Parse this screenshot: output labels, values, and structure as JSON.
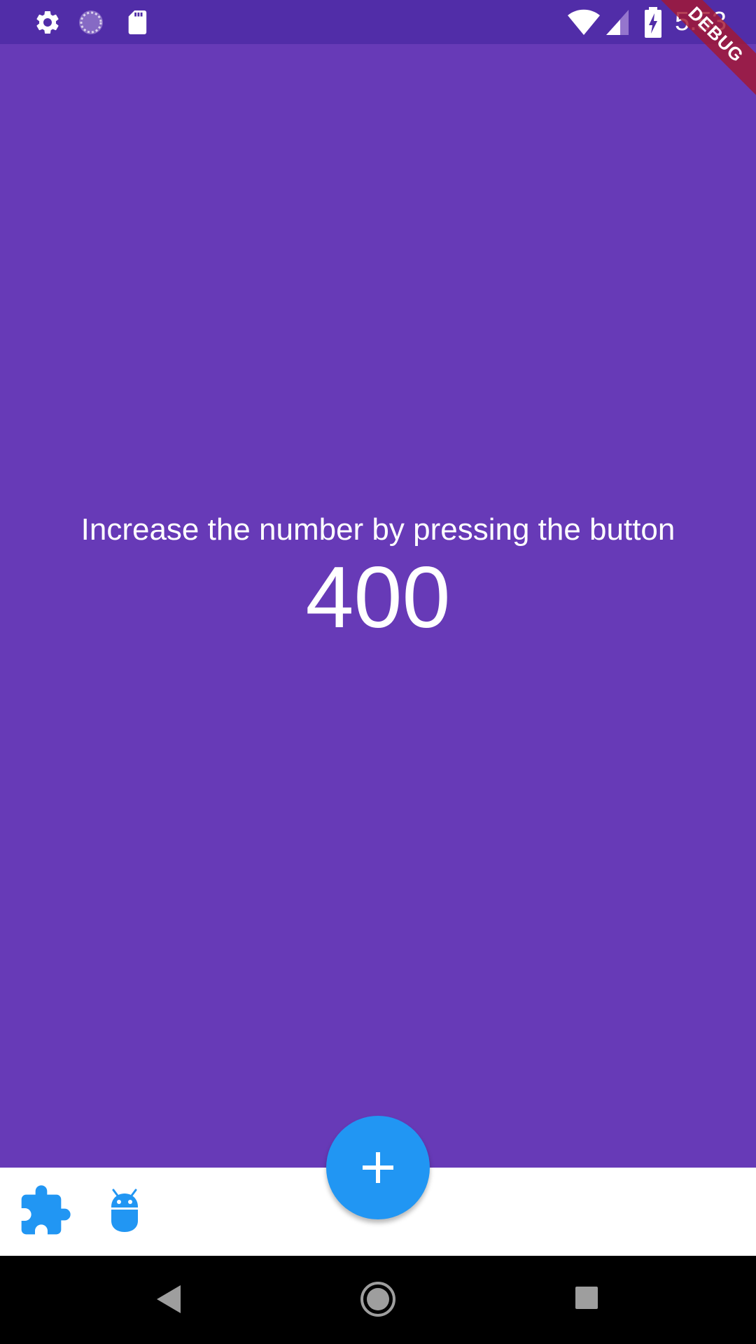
{
  "status_bar": {
    "time": "5:53",
    "icons": [
      "gear-icon",
      "sync-spinner-icon",
      "sd-card-icon",
      "wifi-icon",
      "cell-signal-icon",
      "battery-charging-icon"
    ]
  },
  "debug_banner": {
    "label": "DEBUG"
  },
  "main": {
    "instruction": "Increase the number by pressing the button",
    "counter": "400"
  },
  "bottom_app_bar": {
    "items": [
      {
        "icon": "extension-icon"
      },
      {
        "icon": "android-icon"
      }
    ]
  },
  "fab": {
    "icon": "add-icon"
  },
  "nav_bar": {
    "buttons": [
      "back-icon",
      "home-icon",
      "recents-icon"
    ]
  },
  "colors": {
    "background": "#673ab7",
    "status_bar": "#512da8",
    "accent": "#2196f3",
    "bottom_bar": "#ffffff",
    "debug_banner": "#a41732"
  }
}
